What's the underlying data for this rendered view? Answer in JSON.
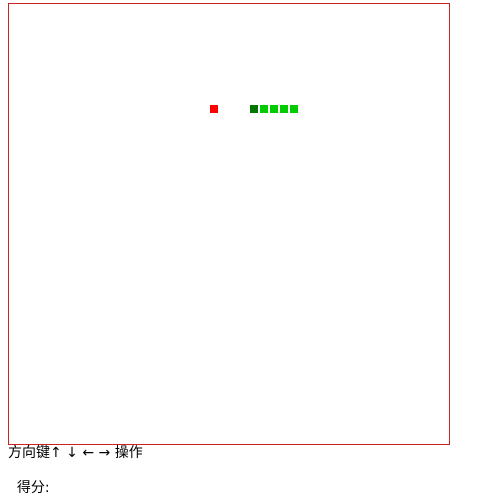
{
  "game": {
    "board": {
      "border_color": "#cc2222",
      "background": "#ffffff",
      "grid_cells": 44
    },
    "food": {
      "color": "#ff0000",
      "cell": [
        20,
        10
      ]
    },
    "snake": {
      "head_color": "#007700",
      "body_color": "#00cc00",
      "cells": [
        [
          24,
          10
        ],
        [
          25,
          10
        ],
        [
          26,
          10
        ],
        [
          27,
          10
        ],
        [
          28,
          10
        ]
      ]
    }
  },
  "controls_text": "方向键↑ ↓ ← → 操作",
  "score_label": "得分:",
  "score_value": ""
}
